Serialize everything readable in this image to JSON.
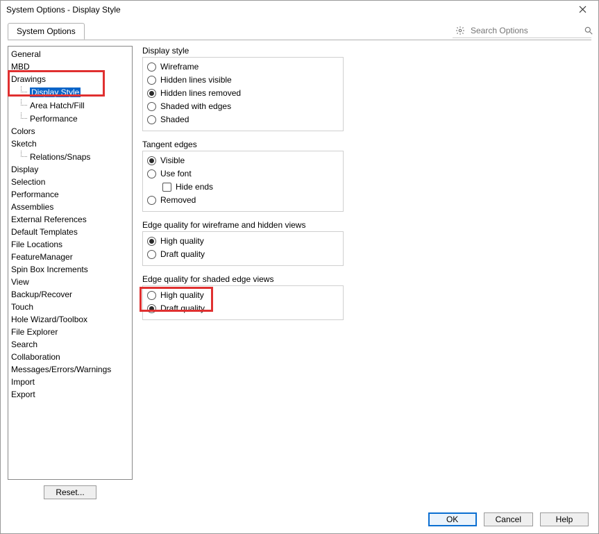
{
  "window": {
    "title": "System Options - Display Style"
  },
  "tabs": {
    "system_options": "System Options"
  },
  "search": {
    "placeholder": "Search Options"
  },
  "sidebar": {
    "items": [
      {
        "label": "General"
      },
      {
        "label": "MBD"
      },
      {
        "label": "Drawings"
      },
      {
        "label": "Display Style",
        "child": true,
        "selected": true
      },
      {
        "label": "Area Hatch/Fill",
        "child": true
      },
      {
        "label": "Performance",
        "child": true
      },
      {
        "label": "Colors"
      },
      {
        "label": "Sketch"
      },
      {
        "label": "Relations/Snaps",
        "child": true
      },
      {
        "label": "Display"
      },
      {
        "label": "Selection"
      },
      {
        "label": "Performance"
      },
      {
        "label": "Assemblies"
      },
      {
        "label": "External References"
      },
      {
        "label": "Default Templates"
      },
      {
        "label": "File Locations"
      },
      {
        "label": "FeatureManager"
      },
      {
        "label": "Spin Box Increments"
      },
      {
        "label": "View"
      },
      {
        "label": "Backup/Recover"
      },
      {
        "label": "Touch"
      },
      {
        "label": "Hole Wizard/Toolbox"
      },
      {
        "label": "File Explorer"
      },
      {
        "label": "Search"
      },
      {
        "label": "Collaboration"
      },
      {
        "label": "Messages/Errors/Warnings"
      },
      {
        "label": "Import"
      },
      {
        "label": "Export"
      }
    ],
    "reset": "Reset..."
  },
  "groups": {
    "display_style": {
      "title": "Display style",
      "opts": [
        {
          "label": "Wireframe",
          "sel": false
        },
        {
          "label": "Hidden lines visible",
          "sel": false
        },
        {
          "label": "Hidden lines removed",
          "sel": true
        },
        {
          "label": "Shaded with edges",
          "sel": false
        },
        {
          "label": "Shaded",
          "sel": false
        }
      ]
    },
    "tangent": {
      "title": "Tangent edges",
      "opts": [
        {
          "label": "Visible",
          "sel": true
        },
        {
          "label": "Use font",
          "sel": false
        },
        {
          "label": "Hide ends",
          "check": true,
          "indent": true,
          "sel": false
        },
        {
          "label": "Removed",
          "sel": false
        }
      ]
    },
    "wire_quality": {
      "title": "Edge quality for wireframe and hidden views",
      "opts": [
        {
          "label": "High quality",
          "sel": true
        },
        {
          "label": "Draft quality",
          "sel": false
        }
      ]
    },
    "shaded_quality": {
      "title": "Edge quality for shaded edge views",
      "opts": [
        {
          "label": "High quality",
          "sel": false
        },
        {
          "label": "Draft quality",
          "sel": true
        }
      ]
    }
  },
  "footer": {
    "ok": "OK",
    "cancel": "Cancel",
    "help": "Help"
  }
}
